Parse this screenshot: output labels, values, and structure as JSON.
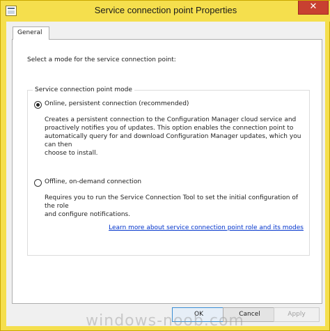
{
  "window": {
    "title": "Service connection point Properties",
    "close_glyph": "✕"
  },
  "tab": {
    "label": "General"
  },
  "panel": {
    "instruction": "Select a mode for the service connection point:",
    "group_title": "Service connection point mode",
    "options": [
      {
        "label": "Online, persistent connection (recommended)",
        "selected": true,
        "description": [
          "Creates a persistent connection to the Configuration Manager cloud service and",
          "proactively notifies you of updates. This option enables the connection point to",
          "automatically query for and download Configuration Manager updates, which you can then",
          "choose to install."
        ]
      },
      {
        "label": "Offline, on-demand connection",
        "selected": false,
        "description": [
          "Requires you to run the Service Connection Tool to set the initial configuration of the role",
          "and configure notifications."
        ]
      }
    ],
    "link": "Learn more about service connection point role and its modes"
  },
  "buttons": {
    "ok": "OK",
    "cancel": "Cancel",
    "apply": "Apply"
  },
  "watermark": "windows-noob.com",
  "colors": {
    "title_bar": "#f5df4d",
    "close_button": "#c84031",
    "link": "#0033cc"
  }
}
